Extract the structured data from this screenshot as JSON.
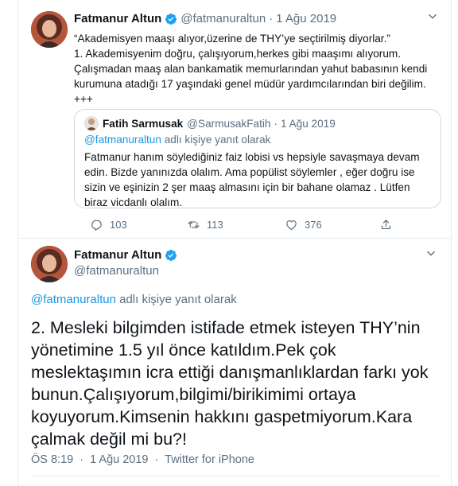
{
  "tweet1": {
    "author_name": "Fatmanur Altun",
    "author_handle": "@fatmanuraltun",
    "separator": "·",
    "date": "1 Ağu 2019",
    "lines": [
      "“Akademisyen maaşı alıyor,üzerine de THY’ye seçtirilmiş diyorlar.”",
      "1. Akademisyenim doğru, çalışıyorum,herkes gibi maaşımı alıyorum. Çalışmadan maaş alan bankamatik memurlarından yahut babasının kendi kurumuna atadığı 17 yaşındaki genel müdür yardımcılarından biri değilim.",
      "+++"
    ],
    "quote": {
      "author_name": "Fatih Sarmusak",
      "author_handle": "@SarmusakFatih",
      "separator": "·",
      "date": "1 Ağu 2019",
      "reply_mention": "@fatmanuraltun",
      "reply_suffix": " adlı kişiye yanıt olarak",
      "text": "Fatmanur hanım söylediğiniz faiz lobisi vs hepsiyle savaşmaya devam edin. Bizde yanınızda olalım. Ama popülist söylemler , eğer doğru ise sizin ve eşinizin 2 şer maaş almasını için bir bahane olamaz  . Lütfen biraz vicdanlı olalım."
    },
    "actions": {
      "replies": "103",
      "retweets": "113",
      "likes": "376"
    }
  },
  "tweet2": {
    "author_name": "Fatmanur Altun",
    "author_handle": "@fatmanuraltun",
    "reply_mention": "@fatmanuraltun",
    "reply_suffix": " adlı kişiye yanıt olarak",
    "text": "2. Mesleki bilgimden istifade etmek isteyen THY’nin yönetimine 1.5 yıl önce katıldım.Pek çok meslektaşımın icra ettiği danışmanlıklardan farkı yok bunun.Çalışıyorum,bilgimi/birikimimi ortaya koyuyorum.Kimsenin hakkını gaspetmiyorum.Kara çalmak değil mi bu?!",
    "time": "ÖS 8:19",
    "separator": "·",
    "date": "1 Ağu 2019",
    "source": "Twitter for iPhone"
  },
  "icons": {
    "verified": "verified-badge-icon",
    "more": "chevron-down-icon",
    "reply": "reply-icon",
    "retweet": "retweet-icon",
    "like": "heart-icon",
    "share": "share-icon"
  },
  "colors": {
    "link": "#1b95e0",
    "secondary_text": "#5b7083",
    "verified": "#1da1f2",
    "border": "#cfd9de"
  }
}
